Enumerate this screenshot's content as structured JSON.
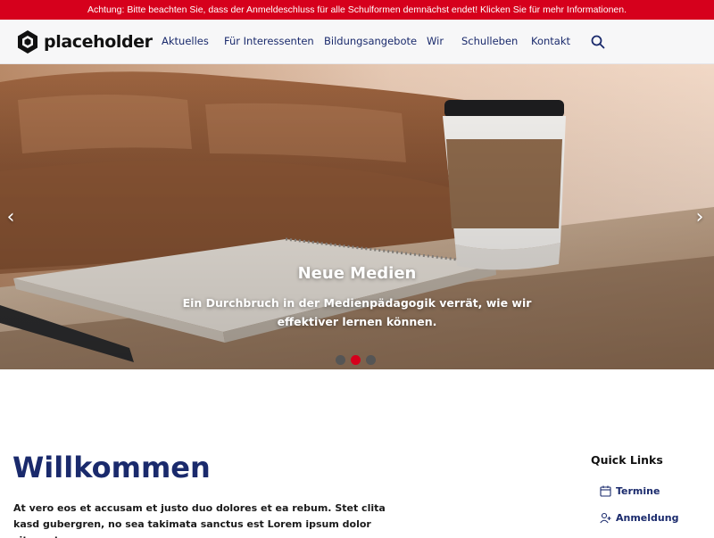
{
  "alert": {
    "text": "Achtung: Bitte beachten Sie, dass der Anmeldeschluss für alle Schulformen demnächst endet! Klicken Sie für mehr Informationen."
  },
  "header": {
    "logo_text": "placeholder",
    "nav": [
      {
        "label": "Aktuelles"
      },
      {
        "label": "Für Interessenten"
      },
      {
        "label": "Bildungsangebote"
      },
      {
        "label": "Wir"
      },
      {
        "label": "Schulleben"
      },
      {
        "label": "Kontakt"
      }
    ],
    "search_icon": "search-icon"
  },
  "hero": {
    "title": "Neue Medien",
    "text": "Ein Durchbruch in der Medienpädagogik verrät, wie wir effektiver lernen können.",
    "prev_glyph": "‹",
    "next_glyph": "›",
    "slide_count": 3,
    "active_slide": 2
  },
  "main": {
    "title": "Willkommen",
    "text": "At vero eos et accusam et justo duo dolores et ea rebum. Stet clita kasd gubergren, no sea takimata sanctus est Lorem ipsum dolor sit amet."
  },
  "quick_links": {
    "title": "Quick Links",
    "items": [
      {
        "label": "Termine",
        "icon": "calendar-icon"
      },
      {
        "label": "Anmeldung",
        "icon": "user-add-icon"
      }
    ]
  },
  "colors": {
    "accent_red": "#d6001c",
    "brand_navy": "#1a2a6c"
  }
}
